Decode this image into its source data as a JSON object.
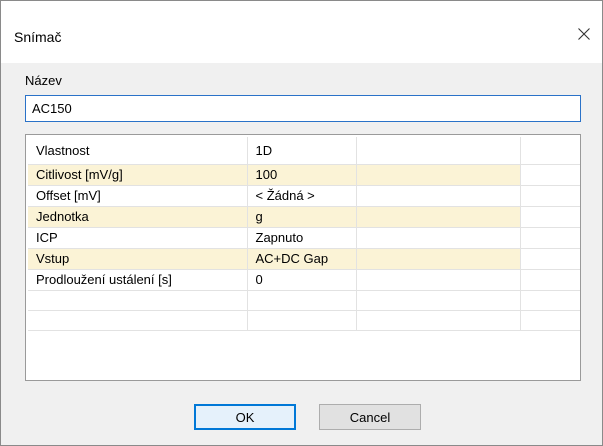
{
  "window": {
    "title": "Snímač",
    "close_icon": "close-icon"
  },
  "name_field": {
    "label": "Název",
    "value": "AC150"
  },
  "grid": {
    "header": {
      "property": "Vlastnost",
      "value": "1D"
    },
    "rows": [
      {
        "property": "Citlivost [mV/g]",
        "value": "100",
        "highlighted": true
      },
      {
        "property": "Offset [mV]",
        "value": "< Žádná >",
        "highlighted": false
      },
      {
        "property": "Jednotka",
        "value": "g",
        "highlighted": true
      },
      {
        "property": "ICP",
        "value": "Zapnuto",
        "highlighted": false
      },
      {
        "property": "Vstup",
        "value": "AC+DC Gap",
        "highlighted": true
      },
      {
        "property": "Prodloužení ustálení [s]",
        "value": "0",
        "highlighted": false
      }
    ],
    "highlight_color": "#fbf3d6"
  },
  "buttons": {
    "ok_label": "OK",
    "cancel_label": "Cancel"
  },
  "colors": {
    "accent": "#0078d7",
    "input_border": "#2a72c8"
  }
}
